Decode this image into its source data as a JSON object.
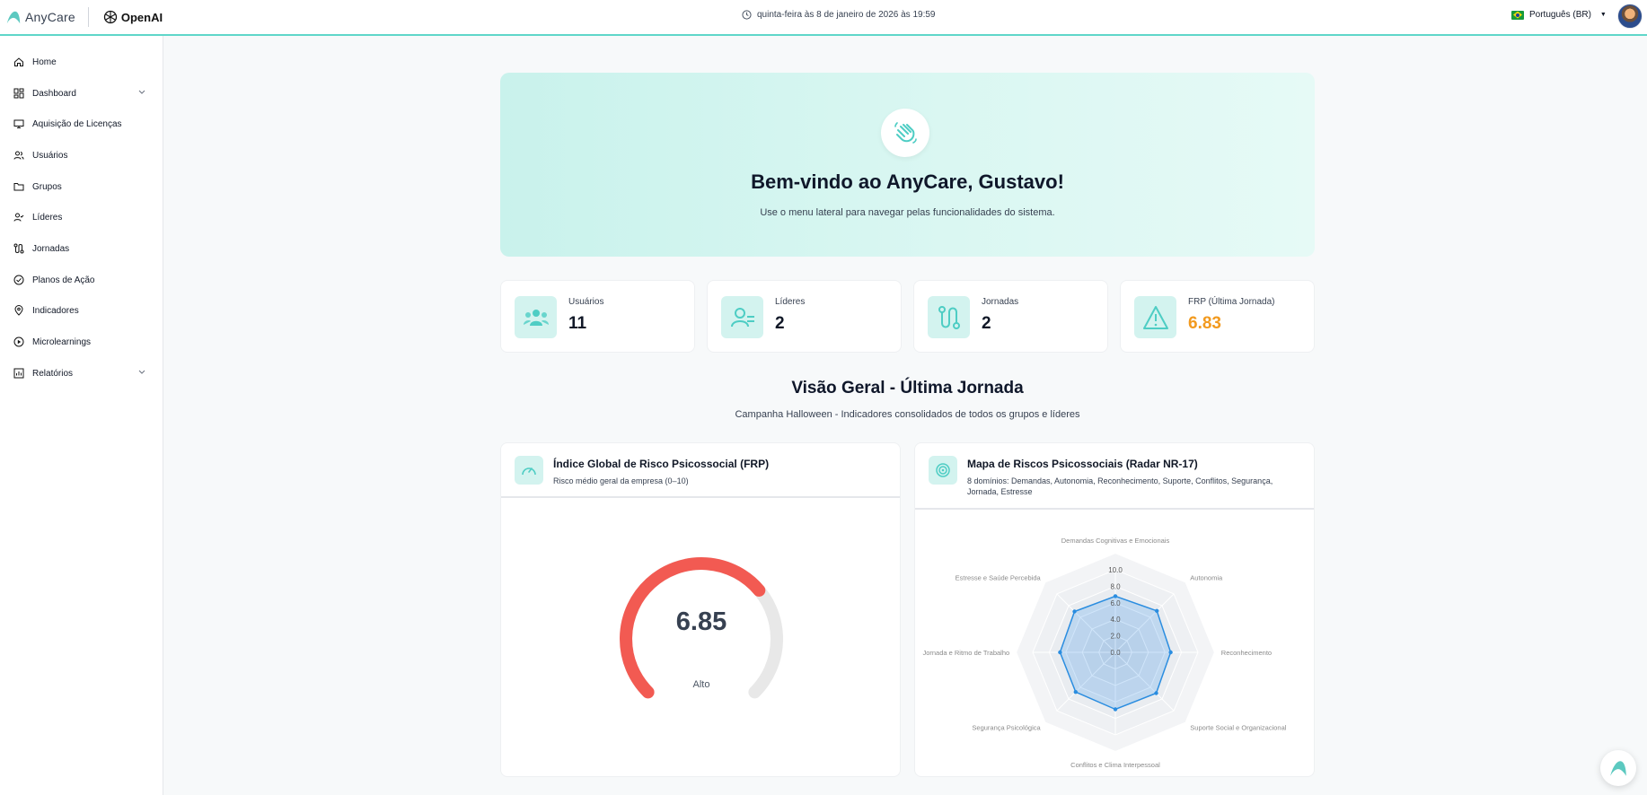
{
  "header": {
    "brand": "AnyCare",
    "partner": "OpenAI",
    "datetime": "quinta-feira às 8 de janeiro de 2026 às 19:59",
    "language": "Português (BR)"
  },
  "sidebar": {
    "items": [
      {
        "label": "Home",
        "icon": "home-icon"
      },
      {
        "label": "Dashboard",
        "icon": "dashboard-icon",
        "expandable": true
      },
      {
        "label": "Aquisição de Licenças",
        "icon": "monitor-icon"
      },
      {
        "label": "Usuários",
        "icon": "users-icon"
      },
      {
        "label": "Grupos",
        "icon": "folder-icon"
      },
      {
        "label": "Líderes",
        "icon": "user-check-icon"
      },
      {
        "label": "Jornadas",
        "icon": "route-icon"
      },
      {
        "label": "Planos de Ação",
        "icon": "check-circle-icon"
      },
      {
        "label": "Indicadores",
        "icon": "location-icon"
      },
      {
        "label": "Microlearnings",
        "icon": "play-circle-icon"
      },
      {
        "label": "Relatórios",
        "icon": "report-icon",
        "expandable": true
      }
    ]
  },
  "welcome": {
    "title": "Bem-vindo ao AnyCare, Gustavo!",
    "subtitle": "Use o menu lateral para navegar pelas funcionalidades do sistema."
  },
  "stats": [
    {
      "label": "Usuários",
      "value": "11",
      "icon": "users-icon"
    },
    {
      "label": "Líderes",
      "value": "2",
      "icon": "user-check-icon"
    },
    {
      "label": "Jornadas",
      "value": "2",
      "icon": "route-icon"
    },
    {
      "label": "FRP (Última Jornada)",
      "value": "6.83",
      "icon": "warning-icon",
      "color": "#f29a1f"
    }
  ],
  "overview": {
    "title": "Visão Geral - Última Jornada",
    "subtitle": "Campanha Halloween - Indicadores consolidados de todos os grupos e líderes"
  },
  "frp_card": {
    "title": "Índice Global de Risco Psicossocial (FRP)",
    "subtitle": "Risco médio geral da empresa (0–10)",
    "value": "6.85",
    "level": "Alto",
    "fraction": 0.685,
    "color": "#f25a52"
  },
  "radar_card": {
    "title": "Mapa de Riscos Psicossociais (Radar NR-17)",
    "subtitle": "8 domínios: Demandas, Autonomia, Reconhecimento, Suporte, Conflitos, Segurança, Jornada, Estresse"
  },
  "chart_data": {
    "type": "radar",
    "categories": [
      "Demandas Cognitivas e Emocionais",
      "Autonomia",
      "Reconhecimento",
      "Suporte Social e Organizacional",
      "Conflitos e Clima Interpessoal",
      "Segurança Psicológica",
      "Jornada e Ritmo de Trabalho",
      "Estresse e Saúde Percebida"
    ],
    "ticks": [
      "0.0",
      "2.0",
      "4.0",
      "6.0",
      "8.0",
      "10.0"
    ],
    "range": [
      0,
      10
    ],
    "series": [
      {
        "values": [
          6.8,
          7.1,
          6.7,
          7.0,
          6.9,
          6.8,
          6.7,
          7.0
        ],
        "color": "#2a8de0"
      }
    ]
  }
}
